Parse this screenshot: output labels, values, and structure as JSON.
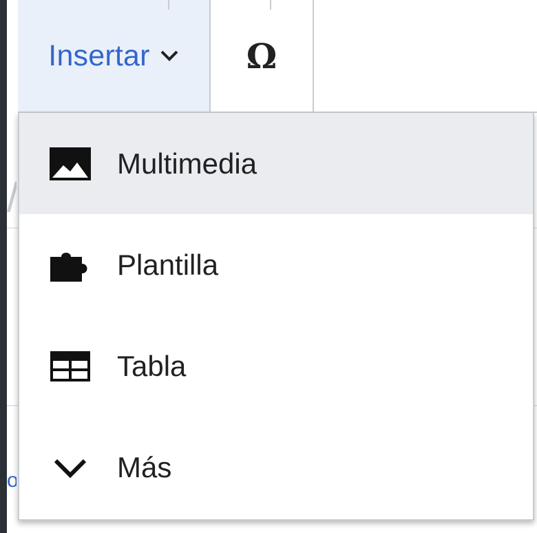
{
  "toolbar": {
    "insert_label": "Insertar",
    "special_characters_label": "Ω"
  },
  "insert_menu": {
    "items": [
      {
        "label": "Multimedia",
        "icon": "image-icon",
        "highlighted": true
      },
      {
        "label": "Plantilla",
        "icon": "puzzle-icon",
        "highlighted": false
      },
      {
        "label": "Tabla",
        "icon": "table-icon",
        "highlighted": false
      },
      {
        "label": "Más",
        "icon": "chevron-down-icon",
        "highlighted": false
      }
    ]
  },
  "colors": {
    "accent": "#3366cc",
    "text": "#202122",
    "border": "#c8ccd1",
    "highlight": "#eaecf0",
    "active_tool_bg": "#eaf0fa",
    "window_frame": "#2b2f36"
  }
}
